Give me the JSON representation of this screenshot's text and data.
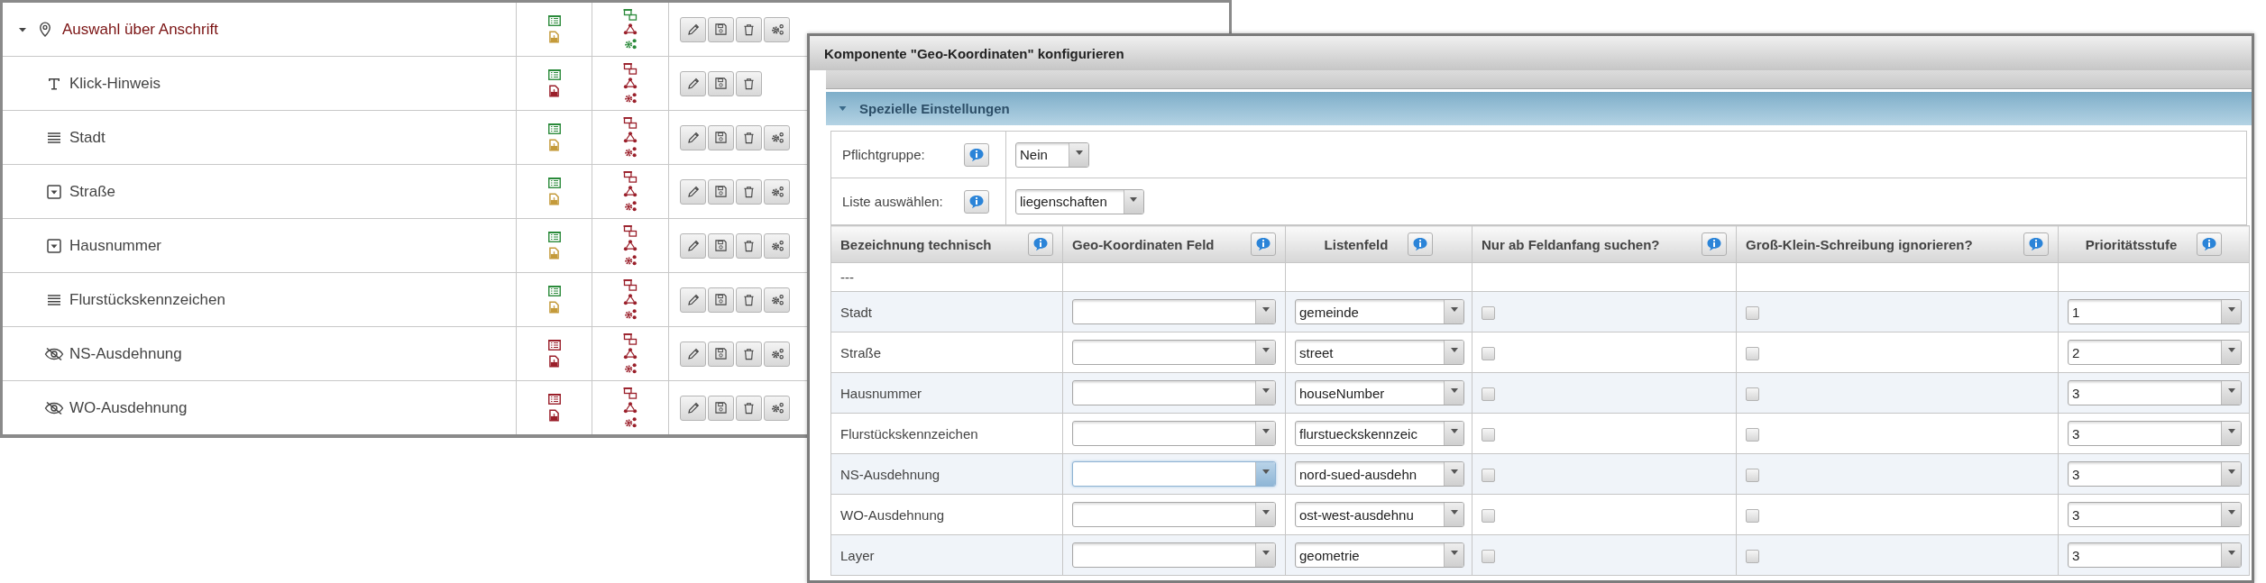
{
  "tree": [
    {
      "kind": "pin",
      "label": "Auswahl über Anschrift",
      "expanded": true,
      "status_icons": [
        {
          "kind": "list",
          "color": "#2a8a3a"
        },
        {
          "kind": "pdf",
          "color": "#c49a3a"
        }
      ],
      "structure_icons": [
        {
          "kind": "windows",
          "color": "#2a8a3a"
        },
        {
          "kind": "connect",
          "color": "#9a1f2a"
        },
        {
          "kind": "gears",
          "color": "#2a8a3a"
        }
      ],
      "actions": [
        {
          "kind": "edit"
        },
        {
          "kind": "save"
        },
        {
          "kind": "delete"
        },
        {
          "kind": "settings"
        }
      ],
      "children": [
        {
          "kind": "text",
          "label": "Klick-Hinweis",
          "status_icons": [
            {
              "kind": "list",
              "color": "#2a8a3a"
            },
            {
              "kind": "pdf",
              "color": "#9a1f2a"
            }
          ],
          "structure_icons": [
            {
              "kind": "windows",
              "color": "#9a1f2a"
            },
            {
              "kind": "connect",
              "color": "#9a1f2a"
            },
            {
              "kind": "gears",
              "color": "#9a1f2a"
            }
          ],
          "actions": [
            {
              "kind": "edit"
            },
            {
              "kind": "save"
            },
            {
              "kind": "delete"
            }
          ]
        },
        {
          "kind": "lines",
          "label": "Stadt",
          "status_icons": [
            {
              "kind": "list",
              "color": "#2a8a3a"
            },
            {
              "kind": "pdf",
              "color": "#c49a3a"
            }
          ],
          "structure_icons": [
            {
              "kind": "windows",
              "color": "#9a1f2a"
            },
            {
              "kind": "connect",
              "color": "#9a1f2a"
            },
            {
              "kind": "gears",
              "color": "#9a1f2a"
            }
          ],
          "actions": [
            {
              "kind": "edit"
            },
            {
              "kind": "save"
            },
            {
              "kind": "delete"
            },
            {
              "kind": "settings"
            }
          ]
        },
        {
          "kind": "dropdown",
          "label": "Straße",
          "status_icons": [
            {
              "kind": "list",
              "color": "#2a8a3a"
            },
            {
              "kind": "pdf",
              "color": "#c49a3a"
            }
          ],
          "structure_icons": [
            {
              "kind": "windows",
              "color": "#9a1f2a"
            },
            {
              "kind": "connect",
              "color": "#9a1f2a"
            },
            {
              "kind": "gears",
              "color": "#9a1f2a"
            }
          ],
          "actions": [
            {
              "kind": "edit"
            },
            {
              "kind": "save"
            },
            {
              "kind": "delete"
            },
            {
              "kind": "settings"
            }
          ]
        },
        {
          "kind": "dropdown",
          "label": "Hausnummer",
          "status_icons": [
            {
              "kind": "list",
              "color": "#2a8a3a"
            },
            {
              "kind": "pdf",
              "color": "#c49a3a"
            }
          ],
          "structure_icons": [
            {
              "kind": "windows",
              "color": "#9a1f2a"
            },
            {
              "kind": "connect",
              "color": "#9a1f2a"
            },
            {
              "kind": "gears",
              "color": "#9a1f2a"
            }
          ],
          "actions": [
            {
              "kind": "edit"
            },
            {
              "kind": "save"
            },
            {
              "kind": "delete"
            },
            {
              "kind": "settings"
            }
          ]
        },
        {
          "kind": "lines",
          "label": "Flurstückskennzeichen",
          "status_icons": [
            {
              "kind": "list",
              "color": "#2a8a3a"
            },
            {
              "kind": "pdf",
              "color": "#c49a3a"
            }
          ],
          "structure_icons": [
            {
              "kind": "windows",
              "color": "#9a1f2a"
            },
            {
              "kind": "connect",
              "color": "#9a1f2a"
            },
            {
              "kind": "gears",
              "color": "#9a1f2a"
            }
          ],
          "actions": [
            {
              "kind": "edit"
            },
            {
              "kind": "save"
            },
            {
              "kind": "delete"
            },
            {
              "kind": "settings"
            }
          ]
        },
        {
          "kind": "hidden",
          "label": "NS-Ausdehnung",
          "status_icons": [
            {
              "kind": "list",
              "color": "#9a1f2a"
            },
            {
              "kind": "pdf",
              "color": "#9a1f2a"
            }
          ],
          "structure_icons": [
            {
              "kind": "windows",
              "color": "#9a1f2a"
            },
            {
              "kind": "connect",
              "color": "#9a1f2a"
            },
            {
              "kind": "gears",
              "color": "#9a1f2a"
            }
          ],
          "actions": [
            {
              "kind": "edit"
            },
            {
              "kind": "save"
            },
            {
              "kind": "delete"
            },
            {
              "kind": "settings"
            }
          ]
        },
        {
          "kind": "hidden",
          "label": "WO-Ausdehnung",
          "status_icons": [
            {
              "kind": "list",
              "color": "#9a1f2a"
            },
            {
              "kind": "pdf",
              "color": "#9a1f2a"
            }
          ],
          "structure_icons": [
            {
              "kind": "windows",
              "color": "#9a1f2a"
            },
            {
              "kind": "connect",
              "color": "#9a1f2a"
            },
            {
              "kind": "gears",
              "color": "#9a1f2a"
            }
          ],
          "actions": [
            {
              "kind": "edit"
            },
            {
              "kind": "save"
            },
            {
              "kind": "delete"
            },
            {
              "kind": "settings"
            }
          ]
        }
      ]
    }
  ],
  "dialog": {
    "title": "Komponente \"Geo-Koordinaten\" konfigurieren",
    "sections": [
      {
        "expanded": false
      },
      {
        "title": "Spezielle Einstellungen",
        "expanded": true
      }
    ],
    "settings": [
      {
        "label": "Pflichtgruppe:",
        "value": "Nein"
      },
      {
        "label": "Liste auswählen:",
        "value": "liegenschaften"
      }
    ],
    "columns": [
      {
        "label": "Bezeichnung technisch"
      },
      {
        "label": "Geo-Koordinaten Feld"
      },
      {
        "label": "Listenfeld"
      },
      {
        "label": "Nur ab Feldanfang suchen?"
      },
      {
        "label": "Groß-Klein-Schreibung ignorieren?"
      },
      {
        "label": "Prioritätsstufe"
      }
    ],
    "rows": [
      {
        "kind": "placeholder",
        "name": "---"
      },
      {
        "kind": "field",
        "name": "Stadt",
        "geo_field": {
          "focused": false
        },
        "list_field": "gemeinde",
        "match_start": false,
        "ignore_case": false,
        "priority": "1"
      },
      {
        "kind": "field",
        "name": "Straße",
        "geo_field": {
          "focused": false
        },
        "list_field": "street",
        "match_start": false,
        "ignore_case": false,
        "priority": "2"
      },
      {
        "kind": "field",
        "name": "Hausnummer",
        "geo_field": {
          "focused": false
        },
        "list_field": "houseNumber",
        "match_start": false,
        "ignore_case": false,
        "priority": "3"
      },
      {
        "kind": "field",
        "name": "Flurstückskennzeichen",
        "geo_field": {
          "focused": false
        },
        "list_field": "flurstueckskennzeic",
        "match_start": false,
        "ignore_case": false,
        "priority": "3"
      },
      {
        "kind": "field",
        "name": "NS-Ausdehnung",
        "geo_field": {
          "focused": true
        },
        "list_field": "nord-sued-ausdehn",
        "match_start": false,
        "ignore_case": false,
        "priority": "3"
      },
      {
        "kind": "field",
        "name": "WO-Ausdehnung",
        "geo_field": {
          "focused": false
        },
        "list_field": "ost-west-ausdehnu",
        "match_start": false,
        "ignore_case": false,
        "priority": "3"
      },
      {
        "kind": "field",
        "name": "Layer",
        "geo_field": {
          "focused": false
        },
        "list_field": "geometrie",
        "match_start": false,
        "ignore_case": false,
        "priority": "3"
      }
    ]
  }
}
